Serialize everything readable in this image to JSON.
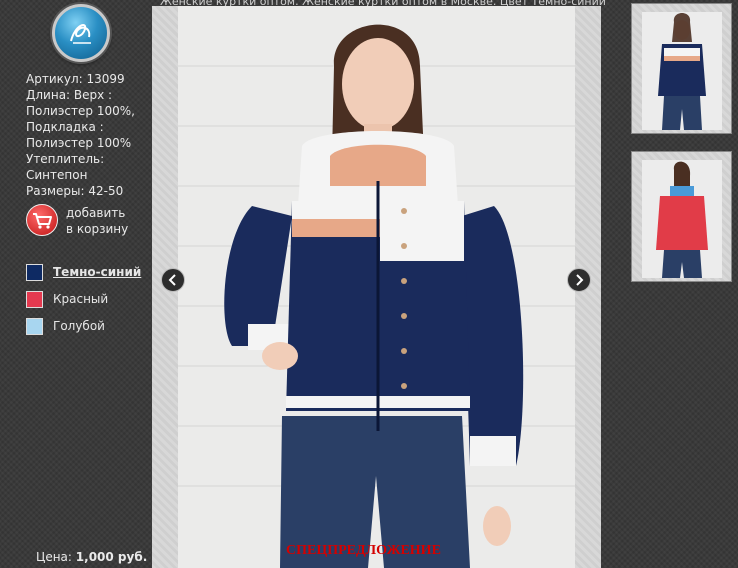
{
  "caption": "Женские куртки оптом. Женские куртки оптом в Москве. Цвет Темно-синий",
  "product": {
    "article": "Артикул: 13099",
    "length": "Длина: Верх :",
    "top": "Полиэстер 100%,",
    "lining_label": "Подкладка :",
    "lining": "Полиэстер 100%",
    "insulation_label": "Утеплитель:",
    "insulation": "Синтепон",
    "sizes": "Размеры: 42-50"
  },
  "cart": {
    "line1": "добавить",
    "line2": "в корзину"
  },
  "colors": [
    {
      "label": "Темно-синий",
      "hex": "#0e2a63"
    },
    {
      "label": "Красный",
      "hex": "#e4394f"
    },
    {
      "label": "Голубой",
      "hex": "#a8d6f0"
    }
  ],
  "price": {
    "label": "Цена:",
    "value": "1,000 руб."
  },
  "special": "СПЕЦПРЕДЛОЖЕНИЕ",
  "colors_style": {
    "navy": "#1a2b5c",
    "red": "#e13c48",
    "denim": "#2a3f66"
  }
}
